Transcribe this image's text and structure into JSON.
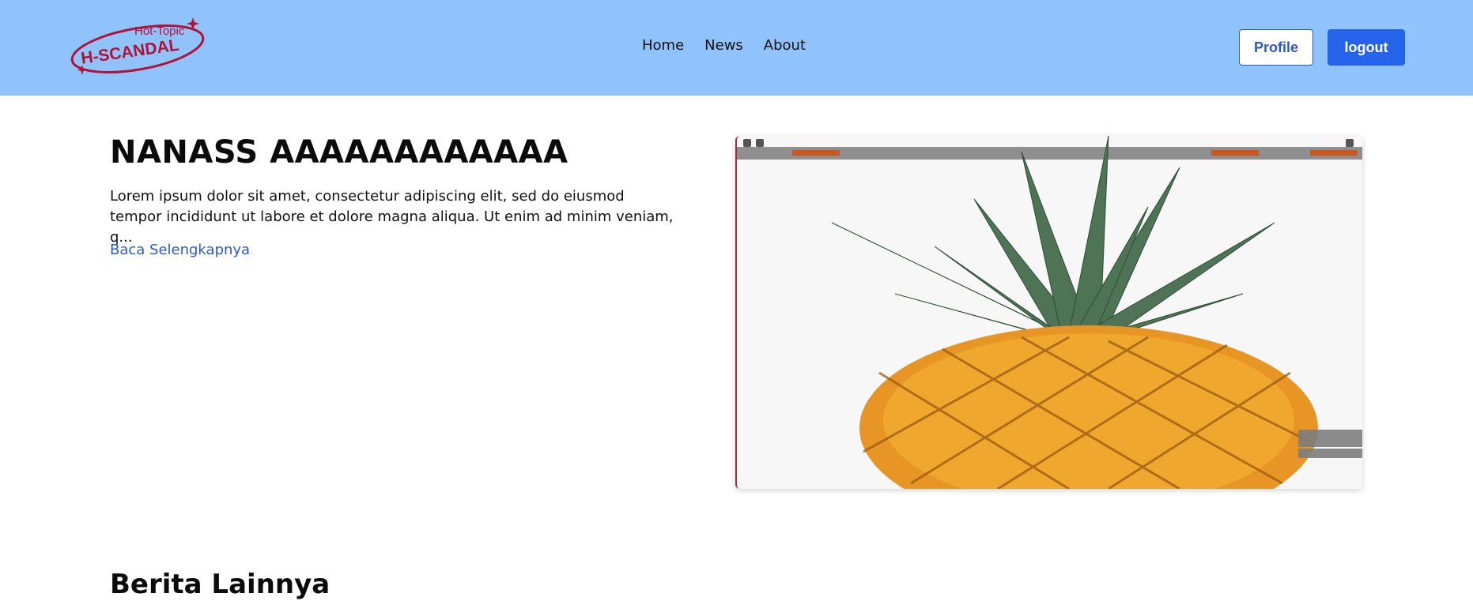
{
  "brand": {
    "logo_top_text": "Hot-Topic",
    "logo_main_text": "H-SCANDAL",
    "logo_color": "#b0123a"
  },
  "nav": {
    "links": [
      "Home",
      "News",
      "About"
    ],
    "profile_label": "Profile",
    "logout_label": "logout",
    "header_bg": "#90c3fb",
    "accent": "#2563eb"
  },
  "featured": {
    "title": "NANASS AAAAAAAAAAAA",
    "excerpt": "Lorem ipsum dolor sit amet, consectetur adipiscing elit, sed do eiusmod tempor incididunt ut labore et dolore magna aliqua. Ut enim ad minim veniam, q...",
    "read_more_label": "Baca Selengkapnya",
    "image_subject": "pineapple"
  },
  "more_news": {
    "heading": "Berita Lainnya"
  }
}
